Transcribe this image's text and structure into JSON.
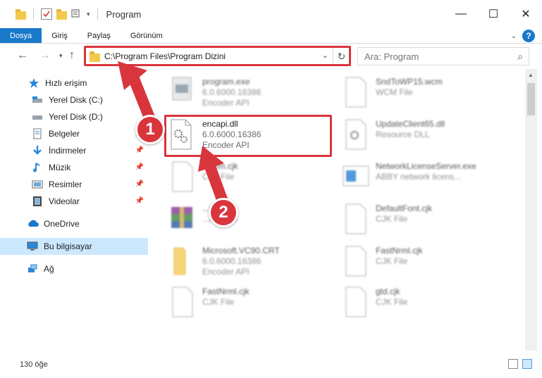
{
  "window": {
    "title": "Program",
    "controls": [
      "—",
      "☐",
      "✕"
    ]
  },
  "ribbon": {
    "tabs": [
      "Dosya",
      "Giriş",
      "Paylaş",
      "Görünüm"
    ],
    "help": "?"
  },
  "nav": {
    "address": "C:\\Program Files\\Program Dizini",
    "search_placeholder": "Ara: Program"
  },
  "sidebar": {
    "items": [
      {
        "label": "Hızlı erişim",
        "icon": "star-icon"
      },
      {
        "label": "Yerel Disk (C:)",
        "icon": "drive-icon"
      },
      {
        "label": "Yerel Disk (D:)",
        "icon": "drive-icon"
      },
      {
        "label": "Belgeler",
        "icon": "documents-icon"
      },
      {
        "label": "İndirmeler",
        "icon": "download-icon"
      },
      {
        "label": "Müzik",
        "icon": "music-icon"
      },
      {
        "label": "Resimler",
        "icon": "pictures-icon"
      },
      {
        "label": "Videolar",
        "icon": "videos-icon"
      },
      {
        "label": "OneDrive",
        "icon": "cloud-icon"
      },
      {
        "label": "Bu bilgisayar",
        "icon": "computer-icon"
      },
      {
        "label": "Ağ",
        "icon": "network-icon"
      }
    ]
  },
  "files": [
    {
      "name": "program.exe",
      "line2": "6.0.6000.16386",
      "line3": "Encoder API"
    },
    {
      "name": "SndToWP15.wcm",
      "line2": "WCM File",
      "line3": ""
    },
    {
      "name": "encapi.dll",
      "line2": "6.0.6000.16386",
      "line3": "Encoder API"
    },
    {
      "name": "UpdateClient65.dll",
      "line2": "Resource DLL",
      "line3": ""
    },
    {
      "name": "...sem.cjk",
      "line2": "CJK File",
      "line3": ""
    },
    {
      "name": "NetworkLicenseServer.exe",
      "line2": "ABBY network licens...",
      "line3": ""
    },
    {
      "name": "...tes.cab",
      "line2": "...Archive",
      "line3": ""
    },
    {
      "name": "DefaultFont.cjk",
      "line2": "CJK File",
      "line3": ""
    },
    {
      "name": "Microsoft.VC90.CRT",
      "line2": "6.0.6000.16386",
      "line3": "Encoder API"
    },
    {
      "name": "FastNrml.cjk",
      "line2": "CJK File",
      "line3": ""
    },
    {
      "name": "FastNrml.cjk",
      "line2": "CJK File",
      "line3": ""
    },
    {
      "name": "gtd.cjk",
      "line2": "CJK File",
      "line3": ""
    }
  ],
  "status": {
    "count": "130 öğe"
  },
  "markers": [
    "1",
    "2"
  ],
  "colors": {
    "accent": "#1979ca",
    "highlight": "#d9353d",
    "selection": "#cce8ff"
  }
}
